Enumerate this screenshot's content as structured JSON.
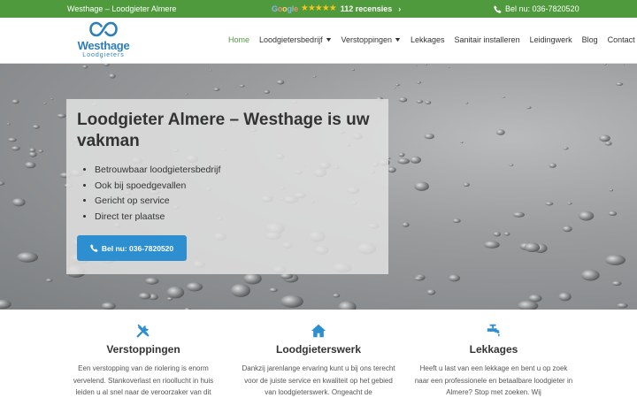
{
  "topbar": {
    "left_text": "Westhage – Loodgieter Almere",
    "google_letters": [
      "G",
      "o",
      "o",
      "g",
      "l",
      "e"
    ],
    "stars": "★★★★★",
    "reviews": "112 recensies",
    "chevron": "›",
    "phone_text": "Bel nu: 036-7820520",
    "accent_color": "#4f9a3c",
    "star_color": "#f5c518"
  },
  "header": {
    "logo_name": "Westhage",
    "logo_sub": "Loodgieters",
    "logo_color": "#2d7fb8",
    "nav": [
      {
        "label": "Home",
        "active": true,
        "dropdown": false
      },
      {
        "label": "Loodgietersbedrijf",
        "active": false,
        "dropdown": true
      },
      {
        "label": "Verstoppingen",
        "active": false,
        "dropdown": true
      },
      {
        "label": "Lekkages",
        "active": false,
        "dropdown": false
      },
      {
        "label": "Sanitair installeren",
        "active": false,
        "dropdown": false
      },
      {
        "label": "Leidingwerk",
        "active": false,
        "dropdown": false
      },
      {
        "label": "Blog",
        "active": false,
        "dropdown": false
      },
      {
        "label": "Contact",
        "active": false,
        "dropdown": true
      }
    ],
    "dropdown_glyph": "▼"
  },
  "hero": {
    "title": "Loodgieter Almere – Westhage is uw vakman",
    "bullets": [
      "Betrouwbaar loodgietersbedrijf",
      "Ook bij spoedgevallen",
      "Gericht op service",
      "Direct ter plaatse"
    ],
    "button_label": "Bel nu: 036-7820520",
    "button_color": "#2d8fd0"
  },
  "services": [
    {
      "icon": "tools-icon",
      "title": "Verstoppingen",
      "text": "Een verstopping van de riolering is enorm vervelend. Stankoverlast en rioollucht in huis leiden u al snel naar de veroorzaker van dit"
    },
    {
      "icon": "home-icon",
      "title": "Loodgieterswerk",
      "text": "Dankzij jarenlange ervaring kunt u bij ons terecht voor de juiste service en kwaliteit op het gebied van loodgieterswerk. Ongeacht de"
    },
    {
      "icon": "faucet-icon",
      "title": "Lekkages",
      "text": "Heeft u last van een lekkage en bent u op zoek naar een professionele en betaalbare loodgieter in Almere? Stop met zoeken. Wij"
    }
  ],
  "icon_color": "#2d8fd0"
}
